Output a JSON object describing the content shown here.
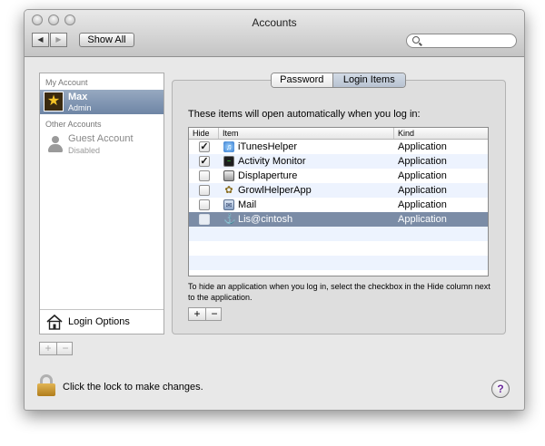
{
  "window": {
    "title": "Accounts"
  },
  "toolbar": {
    "back_glyph": "◀",
    "forward_glyph": "▶",
    "show_all_label": "Show All",
    "search": {
      "value": "",
      "placeholder": ""
    }
  },
  "sidebar": {
    "my_account_header": "My Account",
    "current_user": {
      "name": "Max",
      "role": "Admin",
      "avatar_icon": "star-icon",
      "avatar_glyph": "★"
    },
    "other_accounts_header": "Other Accounts",
    "other_users": [
      {
        "name": "Guest Account",
        "status": "Disabled"
      }
    ],
    "login_options_label": "Login Options",
    "add_glyph": "+",
    "remove_glyph": "−"
  },
  "tabs": [
    {
      "label": "Password",
      "selected": false
    },
    {
      "label": "Login Items",
      "selected": true
    }
  ],
  "login_items": {
    "description": "These items will open automatically when you log in:",
    "columns": [
      "Hide",
      "Item",
      "Kind"
    ],
    "rows": [
      {
        "hide": true,
        "checkmark": "✓",
        "name": "iTunesHelper",
        "kind": "Application",
        "icon": "itunes-helper-icon"
      },
      {
        "hide": true,
        "checkmark": "✓",
        "name": "Activity Monitor",
        "kind": "Application",
        "icon": "activity-monitor-icon"
      },
      {
        "hide": false,
        "checkmark": "",
        "name": "Displaperture",
        "kind": "Application",
        "icon": "display-icon"
      },
      {
        "hide": false,
        "checkmark": "",
        "name": "GrowlHelperApp",
        "kind": "Application",
        "icon": "growl-icon"
      },
      {
        "hide": false,
        "checkmark": "",
        "name": "Mail",
        "kind": "Application",
        "icon": "mail-icon"
      },
      {
        "hide": false,
        "checkmark": "",
        "name": "Lis@cintosh",
        "kind": "Application",
        "icon": "anchor-icon",
        "selected": true
      }
    ],
    "hint": "To hide an application when you log in, select the checkbox in the Hide column next to the application.",
    "add_glyph": "+",
    "remove_glyph": "−"
  },
  "footer": {
    "lock_text": "Click the lock to make changes.",
    "help_glyph": "?"
  },
  "colors": {
    "selection": "#7b8ca6",
    "sidebar_selection": "#6e85a5",
    "row_alt": "#edf3fe"
  }
}
